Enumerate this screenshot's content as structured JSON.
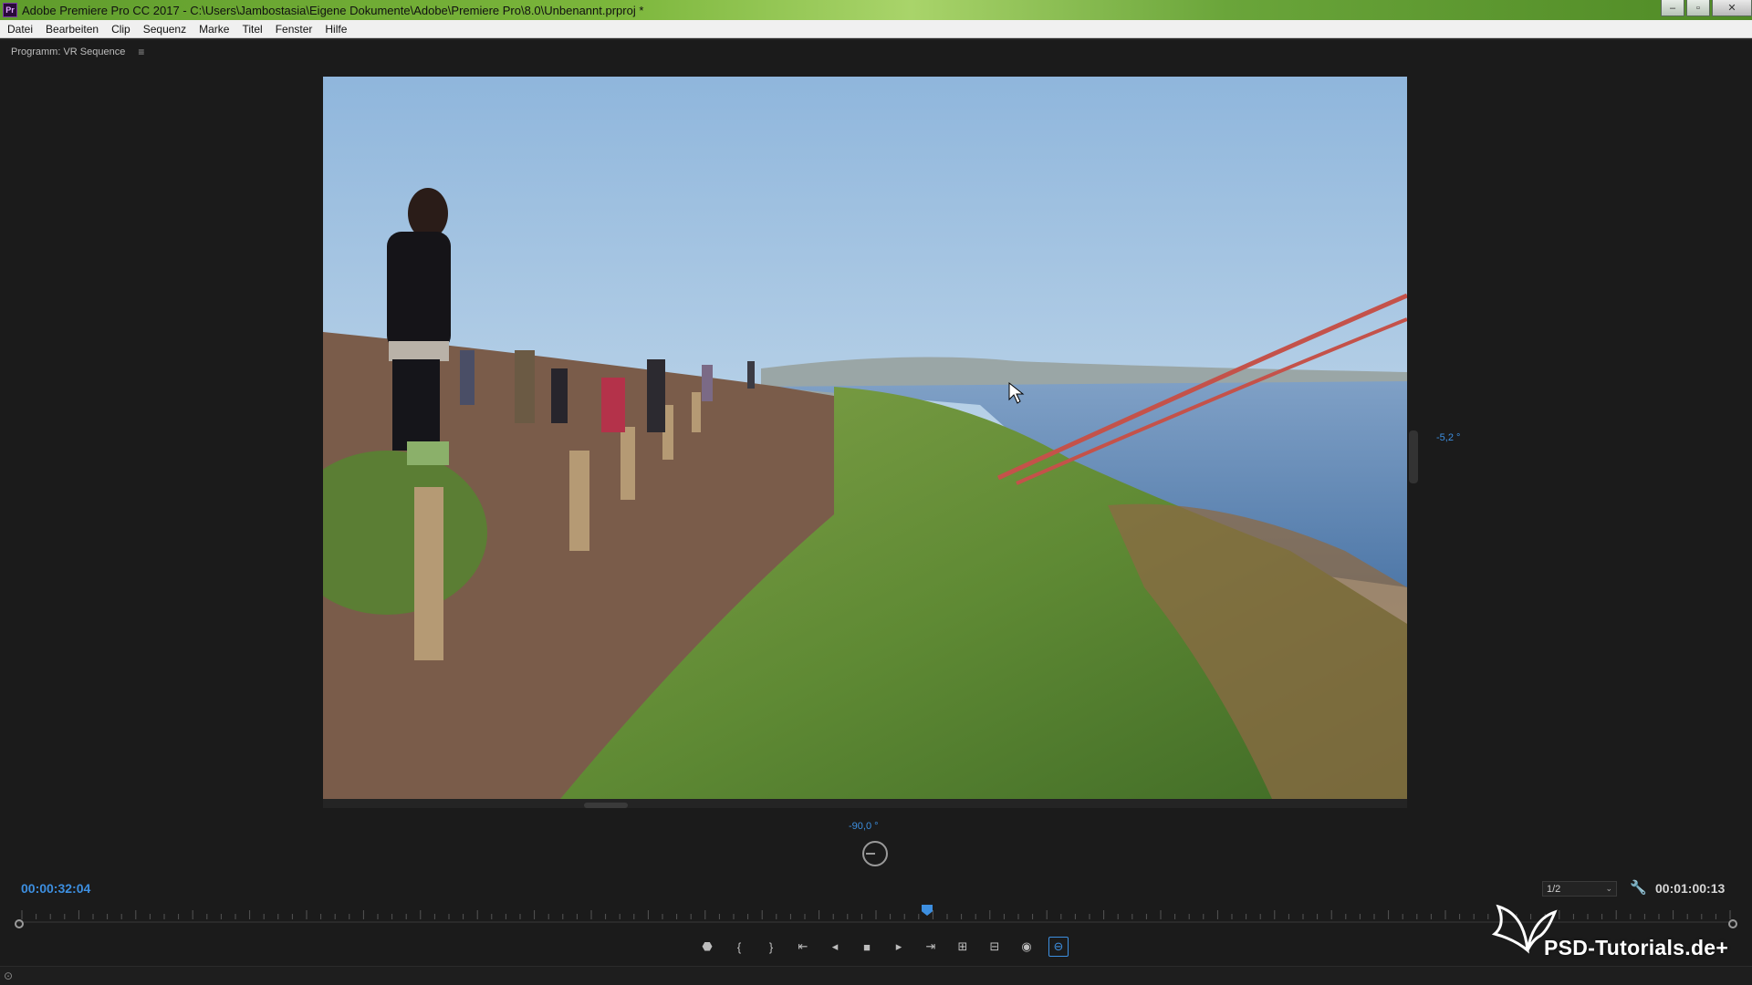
{
  "window": {
    "app_icon": "Pr",
    "title": "Adobe Premiere Pro CC 2017 - C:\\Users\\Jambostasia\\Eigene Dokumente\\Adobe\\Premiere Pro\\8.0\\Unbenannt.prproj *",
    "controls": [
      "minimize-icon",
      "maximize-icon",
      "close-icon"
    ]
  },
  "menu": {
    "items": [
      "Datei",
      "Bearbeiten",
      "Clip",
      "Sequenz",
      "Marke",
      "Titel",
      "Fenster",
      "Hilfe"
    ]
  },
  "panel": {
    "title": "Programm: VR Sequence",
    "menu_icon": "≡"
  },
  "vr": {
    "pitch_readout": "-5,2 °",
    "yaw_readout": "-90,0 °"
  },
  "playback": {
    "current_timecode": "00:00:32:04",
    "duration_timecode": "00:01:00:13",
    "resolution": "1/2"
  },
  "transport": {
    "buttons": [
      {
        "name": "add-marker-icon",
        "glyph": "⬣"
      },
      {
        "name": "mark-in-icon",
        "glyph": "{"
      },
      {
        "name": "mark-out-icon",
        "glyph": "}"
      },
      {
        "name": "go-to-in-icon",
        "glyph": "⇤"
      },
      {
        "name": "step-back-icon",
        "glyph": "◂"
      },
      {
        "name": "stop-icon",
        "glyph": "■"
      },
      {
        "name": "step-forward-icon",
        "glyph": "▸"
      },
      {
        "name": "go-to-out-icon",
        "glyph": "⇥"
      },
      {
        "name": "lift-icon",
        "glyph": "⊞"
      },
      {
        "name": "extract-icon",
        "glyph": "⊟"
      },
      {
        "name": "export-frame-icon",
        "glyph": "◉"
      },
      {
        "name": "vr-video-toggle-icon",
        "glyph": "⊖"
      }
    ]
  },
  "watermark": {
    "text": "PSD-Tutorials.de+"
  },
  "colors": {
    "accent": "#3d8fe0",
    "title_bar": "#7bb63b",
    "panel_bg": "#1b1b1b"
  }
}
